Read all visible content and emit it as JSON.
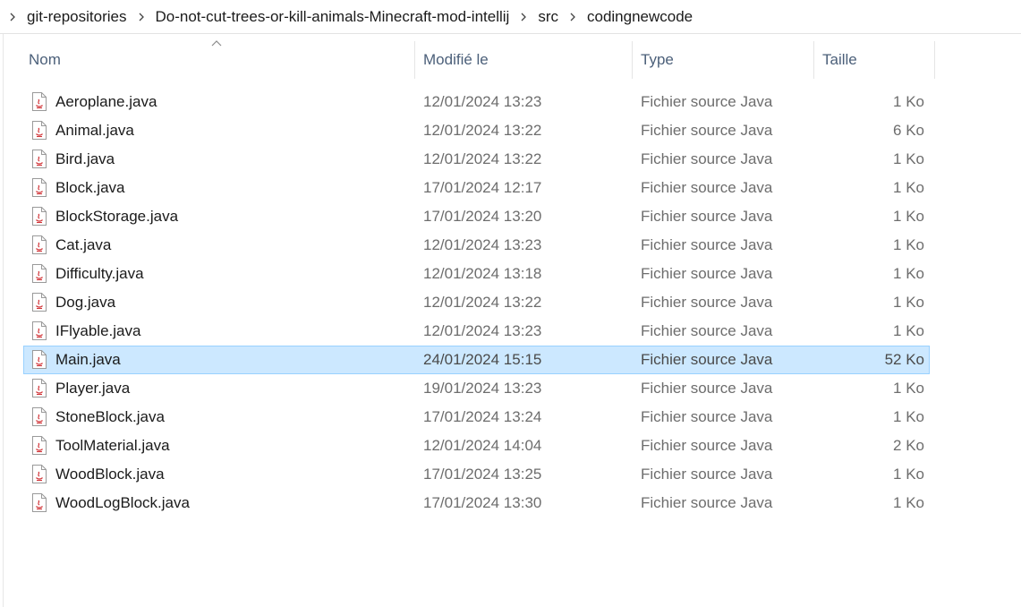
{
  "breadcrumb": [
    "git-repositories",
    "Do-not-cut-trees-or-kill-animals-Minecraft-mod-intellij",
    "src",
    "codingnewcode"
  ],
  "columns": {
    "name": "Nom",
    "modified": "Modifié le",
    "type": "Type",
    "size": "Taille"
  },
  "sort": {
    "column": "name",
    "direction": "ascending"
  },
  "selected_file": "Main.java",
  "accent": {
    "selection_bg": "#cce8ff",
    "selection_border": "#99d1ff",
    "java_icon": "#d13438"
  },
  "files": [
    {
      "name": "Aeroplane.java",
      "modified": "12/01/2024 13:23",
      "type": "Fichier source Java",
      "size": "1 Ko",
      "icon": "java-file-icon"
    },
    {
      "name": "Animal.java",
      "modified": "12/01/2024 13:22",
      "type": "Fichier source Java",
      "size": "6 Ko",
      "icon": "java-file-icon"
    },
    {
      "name": "Bird.java",
      "modified": "12/01/2024 13:22",
      "type": "Fichier source Java",
      "size": "1 Ko",
      "icon": "java-file-icon"
    },
    {
      "name": "Block.java",
      "modified": "17/01/2024 12:17",
      "type": "Fichier source Java",
      "size": "1 Ko",
      "icon": "java-file-icon"
    },
    {
      "name": "BlockStorage.java",
      "modified": "17/01/2024 13:20",
      "type": "Fichier source Java",
      "size": "1 Ko",
      "icon": "java-file-icon"
    },
    {
      "name": "Cat.java",
      "modified": "12/01/2024 13:23",
      "type": "Fichier source Java",
      "size": "1 Ko",
      "icon": "java-file-icon"
    },
    {
      "name": "Difficulty.java",
      "modified": "12/01/2024 13:18",
      "type": "Fichier source Java",
      "size": "1 Ko",
      "icon": "java-file-icon"
    },
    {
      "name": "Dog.java",
      "modified": "12/01/2024 13:22",
      "type": "Fichier source Java",
      "size": "1 Ko",
      "icon": "java-file-icon"
    },
    {
      "name": "IFlyable.java",
      "modified": "12/01/2024 13:23",
      "type": "Fichier source Java",
      "size": "1 Ko",
      "icon": "java-file-icon"
    },
    {
      "name": "Main.java",
      "modified": "24/01/2024 15:15",
      "type": "Fichier source Java",
      "size": "52 Ko",
      "icon": "java-file-icon"
    },
    {
      "name": "Player.java",
      "modified": "19/01/2024 13:23",
      "type": "Fichier source Java",
      "size": "1 Ko",
      "icon": "java-file-icon"
    },
    {
      "name": "StoneBlock.java",
      "modified": "17/01/2024 13:24",
      "type": "Fichier source Java",
      "size": "1 Ko",
      "icon": "java-file-icon"
    },
    {
      "name": "ToolMaterial.java",
      "modified": "12/01/2024 14:04",
      "type": "Fichier source Java",
      "size": "2 Ko",
      "icon": "java-file-icon"
    },
    {
      "name": "WoodBlock.java",
      "modified": "17/01/2024 13:25",
      "type": "Fichier source Java",
      "size": "1 Ko",
      "icon": "java-file-icon"
    },
    {
      "name": "WoodLogBlock.java",
      "modified": "17/01/2024 13:30",
      "type": "Fichier source Java",
      "size": "1 Ko",
      "icon": "java-file-icon"
    }
  ]
}
